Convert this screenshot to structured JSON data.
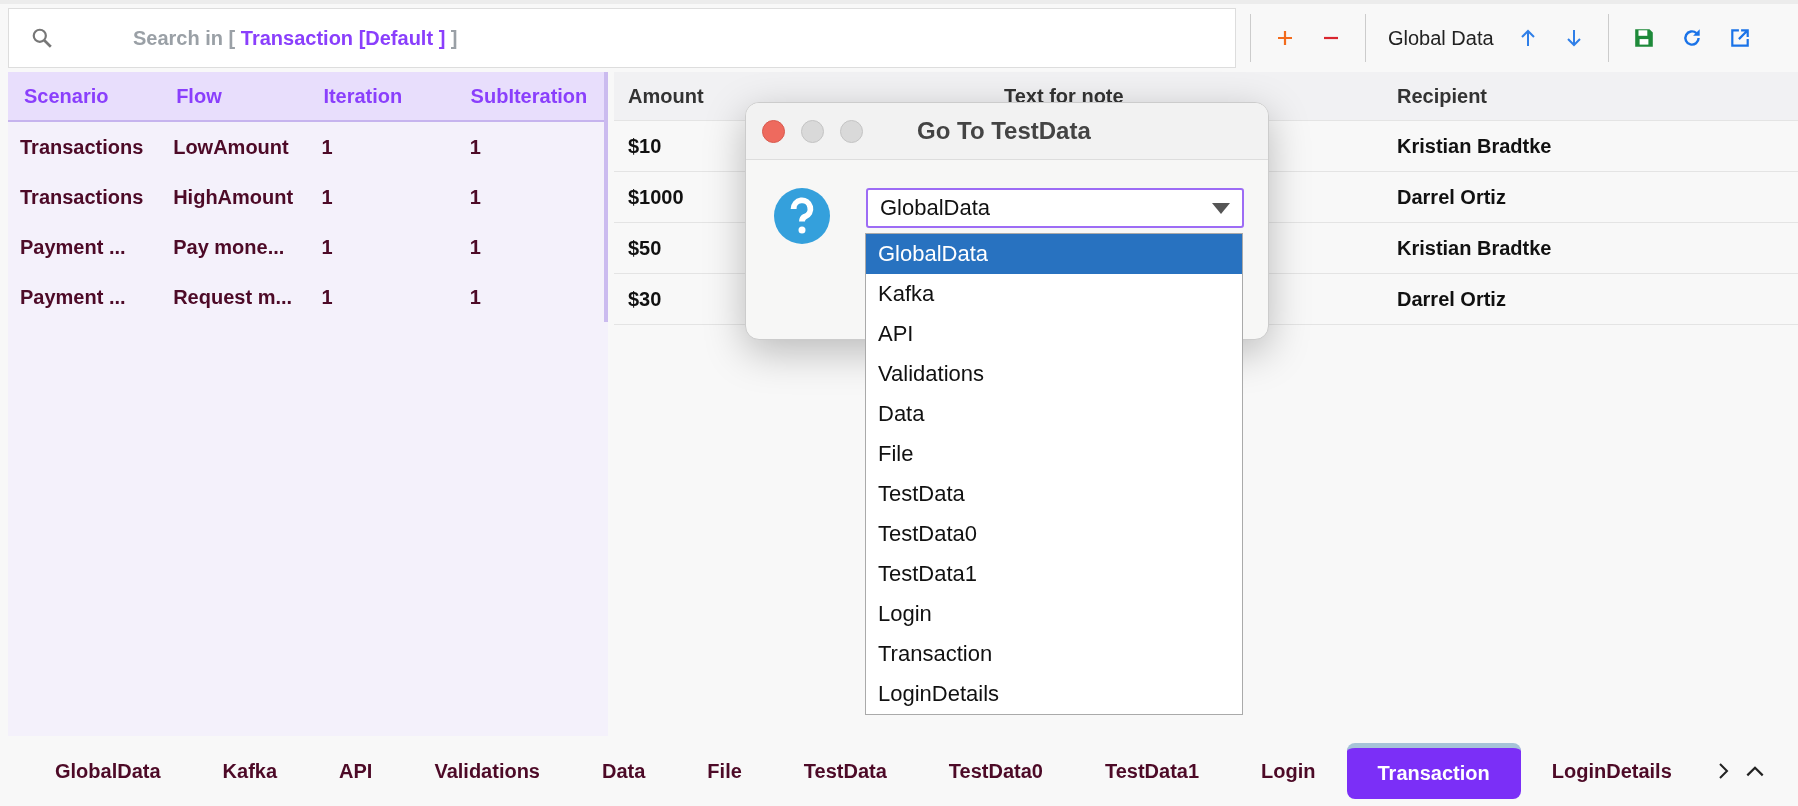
{
  "search": {
    "prefix": "Search in [",
    "scope": "Transaction [Default ]",
    "suffix": "]"
  },
  "toolbar": {
    "data_label": "Global Data"
  },
  "left_table": {
    "columns": [
      "Scenario",
      "Flow",
      "Iteration",
      "SubIteration"
    ],
    "rows": [
      [
        "Transactions",
        "LowAmount",
        "1",
        "1"
      ],
      [
        "Transactions",
        "HighAmount",
        "1",
        "1"
      ],
      [
        "Payment ...",
        "Pay mone...",
        "1",
        "1"
      ],
      [
        "Payment ...",
        "Request m...",
        "1",
        "1"
      ]
    ]
  },
  "right_table": {
    "columns": [
      "Amount",
      "Text for note",
      "Recipient"
    ],
    "rows": [
      {
        "amount": "$10",
        "recipient": "Kristian Bradtke"
      },
      {
        "amount": "$1000",
        "recipient": "Darrel Ortiz"
      },
      {
        "amount": "$50",
        "recipient": "Kristian Bradtke"
      },
      {
        "amount": "$30",
        "recipient": "Darrel Ortiz"
      }
    ]
  },
  "dialog": {
    "title": "Go To TestData",
    "value": "GlobalData",
    "options": [
      {
        "label": "GlobalData",
        "selected": true
      },
      {
        "label": "Kafka",
        "selected": false
      },
      {
        "label": "API",
        "selected": false
      },
      {
        "label": "Validations",
        "selected": false
      },
      {
        "label": "Data",
        "selected": false
      },
      {
        "label": "File",
        "selected": false
      },
      {
        "label": "TestData",
        "selected": false
      },
      {
        "label": "TestData0",
        "selected": false
      },
      {
        "label": "TestData1",
        "selected": false
      },
      {
        "label": "Login",
        "selected": false
      },
      {
        "label": "Transaction",
        "selected": false
      },
      {
        "label": "LoginDetails",
        "selected": false
      }
    ]
  },
  "sheet_tabs": [
    {
      "label": "GlobalData",
      "selected": false
    },
    {
      "label": "Kafka",
      "selected": false
    },
    {
      "label": "API",
      "selected": false
    },
    {
      "label": "Validations",
      "selected": false
    },
    {
      "label": "Data",
      "selected": false
    },
    {
      "label": "File",
      "selected": false
    },
    {
      "label": "TestData",
      "selected": false
    },
    {
      "label": "TestData0",
      "selected": false
    },
    {
      "label": "TestData1",
      "selected": false
    },
    {
      "label": "Login",
      "selected": false
    },
    {
      "label": "Transaction",
      "selected": true
    },
    {
      "label": "LoginDetails",
      "selected": false
    }
  ]
}
